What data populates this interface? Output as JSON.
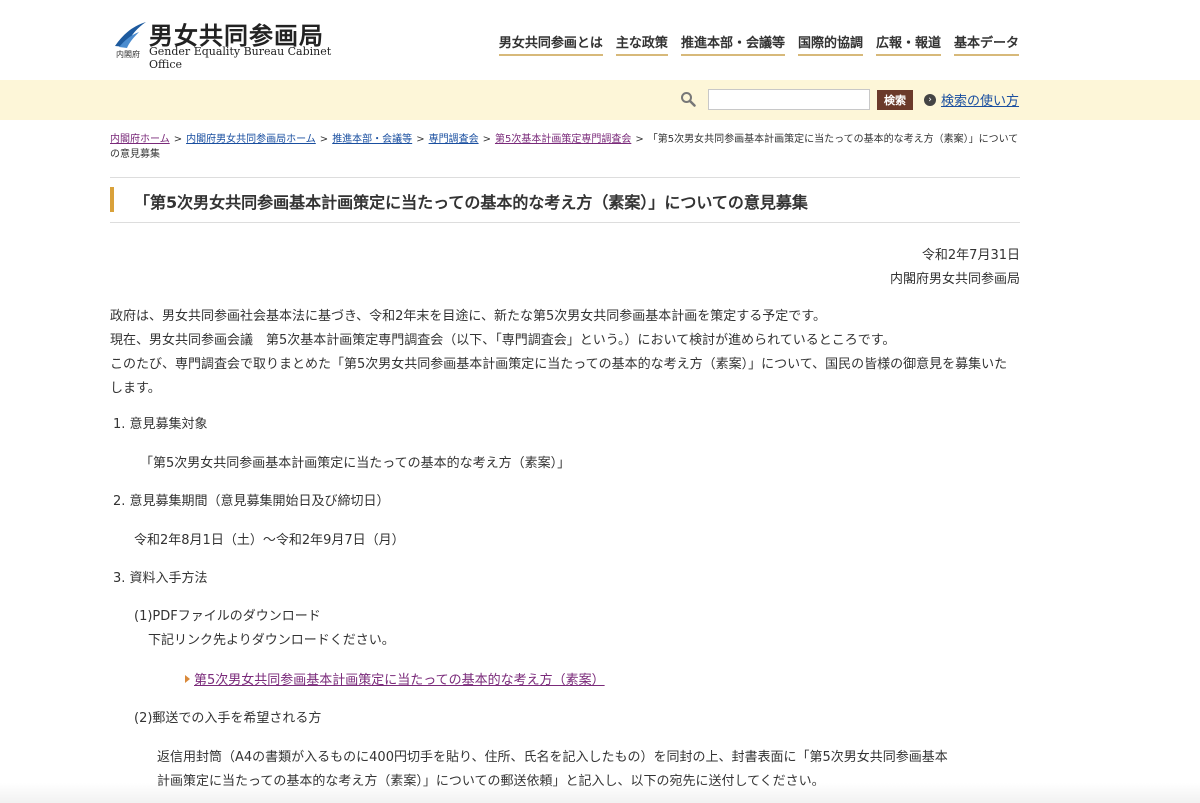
{
  "header": {
    "logo_title": "男女共同参画局",
    "logo_subtitle": "Gender Equality Bureau Cabinet Office",
    "logo_office": "内閣府",
    "nav": [
      "男女共同参画とは",
      "主な政策",
      "推進本部・会議等",
      "国際的協調",
      "広報・報道",
      "基本データ"
    ]
  },
  "search": {
    "button_label": "検索",
    "help_label": "検索の使い方",
    "value": ""
  },
  "breadcrumb": {
    "items": [
      "内閣府ホーム",
      "内閣府男女共同参画局ホーム",
      "推進本部・会議等",
      "専門調査会",
      "第5次基本計画策定専門調査会"
    ],
    "current": "「第5次男女共同参画基本計画策定に当たっての基本的な考え方（素案）」についての意見募集"
  },
  "page": {
    "title": "「第5次男女共同参画基本計画策定に当たっての基本的な考え方（素案）」についての意見募集",
    "date": "令和2年7月31日",
    "author": "内閣府男女共同参画局",
    "intro": [
      "政府は、男女共同参画社会基本法に基づき、令和2年末を目途に、新たな第5次男女共同参画基本計画を策定する予定です。",
      "現在、男女共同参画会議　第5次基本計画策定専門調査会（以下、「専門調査会」という。）において検討が進められているところです。",
      "このたび、専門調査会で取りまとめた「第5次男女共同参画基本計画策定に当たっての基本的な考え方（素案）」について、国民の皆様の御意見を募集いたします。"
    ]
  },
  "sections": {
    "s1_heading": "1.  意見募集対象",
    "s1_body": "「第5次男女共同参画基本計画策定に当たっての基本的な考え方（素案）」",
    "s2_heading": "2.  意見募集期間（意見募集開始日及び締切日）",
    "s2_body": "令和2年8月1日（土）～令和2年9月7日（月）",
    "s3_heading": "3.  資料入手方法",
    "s3_sub1": "(1)PDFファイルのダウンロード",
    "s3_sub1_body": "下記リンク先よりダウンロードください。",
    "s3_link": "第5次男女共同参画基本計画策定に当たっての基本的な考え方（素案）",
    "s3_sub2": "(2)郵送での入手を希望される方",
    "s3_sub2_body": [
      "返信用封筒（A4の書類が入るものに400円切手を貼り、住所、氏名を記入したもの）を同封の上、封書表面に「第5次男女共同参画基本",
      "計画策定に当たっての基本的な考え方（素案）」についての郵送依頼」と記入し、以下の宛先に送付してください。"
    ]
  }
}
